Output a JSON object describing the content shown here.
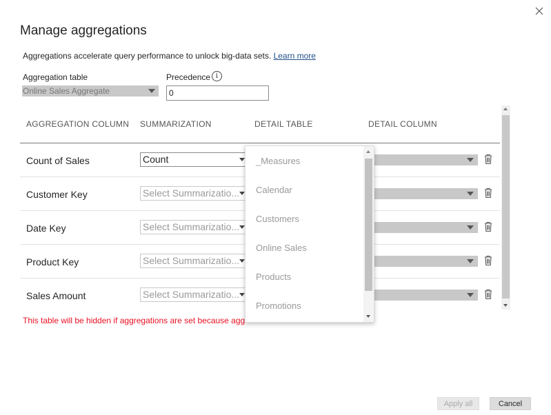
{
  "dialog": {
    "title": "Manage aggregations",
    "description": "Aggregations accelerate query performance to unlock big-data sets.",
    "learn_more": "Learn more",
    "close_icon": "close-icon"
  },
  "aggregation_table": {
    "label": "Aggregation table",
    "value": "Online Sales Aggregate"
  },
  "precedence": {
    "label": "Precedence",
    "info_icon": "i",
    "value": "0"
  },
  "columns": {
    "aggregation_column": "AGGREGATION COLUMN",
    "summarization": "SUMMARIZATION",
    "detail_table": "DETAIL TABLE",
    "detail_column": "DETAIL COLUMN"
  },
  "rows": [
    {
      "label": "Count of Sales",
      "summarization": "Count"
    },
    {
      "label": "Customer Key",
      "summarization": "Select Summarizatio..."
    },
    {
      "label": "Date Key",
      "summarization": "Select Summarizatio..."
    },
    {
      "label": "Product Key",
      "summarization": "Select Summarizatio..."
    },
    {
      "label": "Sales Amount",
      "summarization": "Select Summarizatio..."
    }
  ],
  "detail_table_dropdown": {
    "options": [
      "_Measures",
      "Calendar",
      "Customers",
      "Online Sales",
      "Products",
      "Promotions"
    ]
  },
  "warning": "This table will be hidden if aggregations are set because agg",
  "buttons": {
    "apply_all": "Apply all",
    "cancel": "Cancel"
  },
  "colors": {
    "warning": "#e81123",
    "link": "#1f4e8a",
    "disabled_field": "#c8c8c8"
  }
}
